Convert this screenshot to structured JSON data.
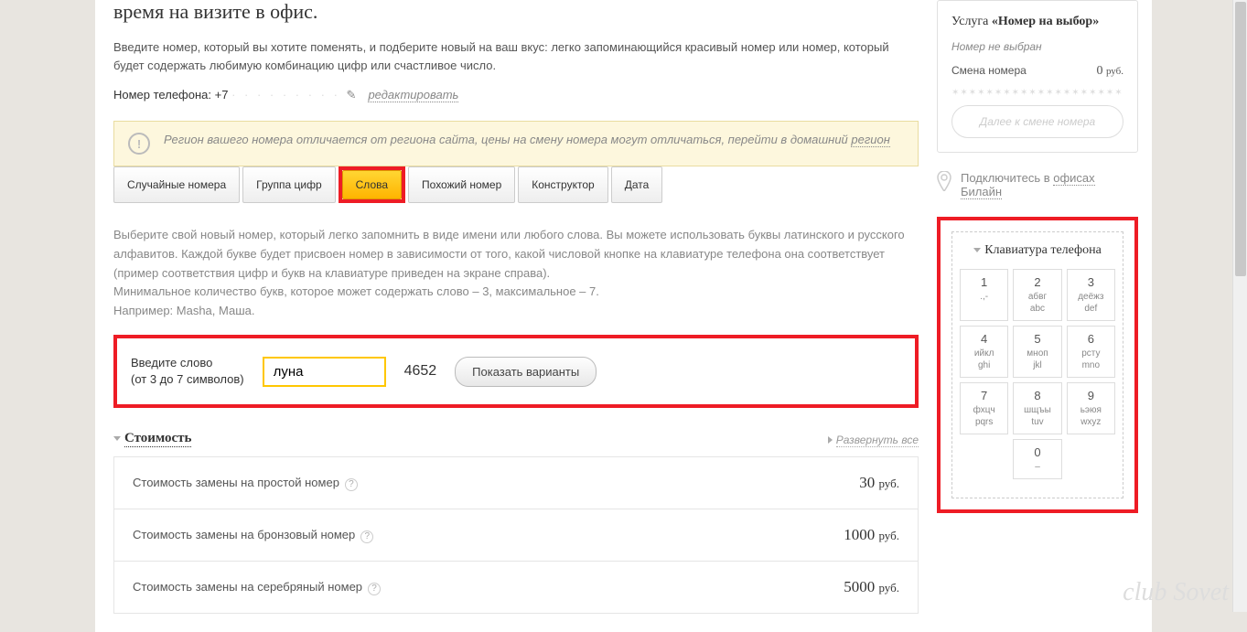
{
  "page": {
    "title_fragment": "время на визите в офис.",
    "intro": "Введите номер, который вы хотите поменять, и подберите новый на ваш вкус: легко запоминающийся красивый номер или номер, который будет содержать любимую комбинацию цифр или счастливое число.",
    "phone_label": "Номер телефона: +7",
    "edit_label": "редактировать"
  },
  "warning": {
    "text_1": "Регион вашего номера отличается от региона сайта, цены на смену номера могут отличаться, перейти в домашний ",
    "link": "регион"
  },
  "tabs": [
    {
      "label": "Случайные номера",
      "active": false
    },
    {
      "label": "Группа цифр",
      "active": false
    },
    {
      "label": "Слова",
      "active": true
    },
    {
      "label": "Похожий номер",
      "active": false
    },
    {
      "label": "Конструктор",
      "active": false
    },
    {
      "label": "Дата",
      "active": false
    }
  ],
  "helper": "Выберите свой новый номер, который легко запомнить в виде имени или любого слова. Вы можете использовать буквы латинского и русского алфавитов. Каждой букве будет присвоен номер в зависимости от того, какой числовой кнопке на клавиатуре телефона она соответствует (пример соответствия цифр и букв на клавиатуре приведен на экране справа).\nМинимальное количество букв, которое может содержать слово – 3, максимальное – 7.\nНапример: Masha, Маша.",
  "word_input": {
    "label_1": "Введите слово",
    "label_2": "(от 3 до 7 символов)",
    "value": "луна",
    "number": "4652",
    "button": "Показать варианты"
  },
  "cost": {
    "title": "Стоимость",
    "expand": "Развернуть все",
    "rows": [
      {
        "label": "Стоимость замены на простой номер",
        "value": "30",
        "unit": "руб."
      },
      {
        "label": "Стоимость замены на бронзовый номер",
        "value": "1000",
        "unit": "руб."
      },
      {
        "label": "Стоимость замены на серебряный номер",
        "value": "5000",
        "unit": "руб."
      }
    ]
  },
  "sidebar": {
    "service_prefix": "Услуга ",
    "service_name": "«Номер на выбор»",
    "no_number": "Номер не выбран",
    "change_label": "Смена номера",
    "change_value": "0",
    "change_unit": "руб.",
    "continue": "Далее к смене номера",
    "office_text_1": "Подключитесь в ",
    "office_link": "офисах",
    "office_text_2": "Билайн"
  },
  "keypad": {
    "title": "Клавиатура телефона",
    "keys": [
      {
        "digit": "1",
        "ru": ".,-",
        "en": ""
      },
      {
        "digit": "2",
        "ru": "абвг",
        "en": "abc"
      },
      {
        "digit": "3",
        "ru": "деёжз",
        "en": "def"
      },
      {
        "digit": "4",
        "ru": "ийкл",
        "en": "ghi"
      },
      {
        "digit": "5",
        "ru": "мноп",
        "en": "jkl"
      },
      {
        "digit": "6",
        "ru": "рсту",
        "en": "mno"
      },
      {
        "digit": "7",
        "ru": "фхцч",
        "en": "pqrs"
      },
      {
        "digit": "8",
        "ru": "шщъы",
        "en": "tuv"
      },
      {
        "digit": "9",
        "ru": "ьэюя",
        "en": "wxyz"
      },
      {
        "digit": "0",
        "ru": "–",
        "en": ""
      }
    ]
  },
  "watermark": "club Sovet"
}
